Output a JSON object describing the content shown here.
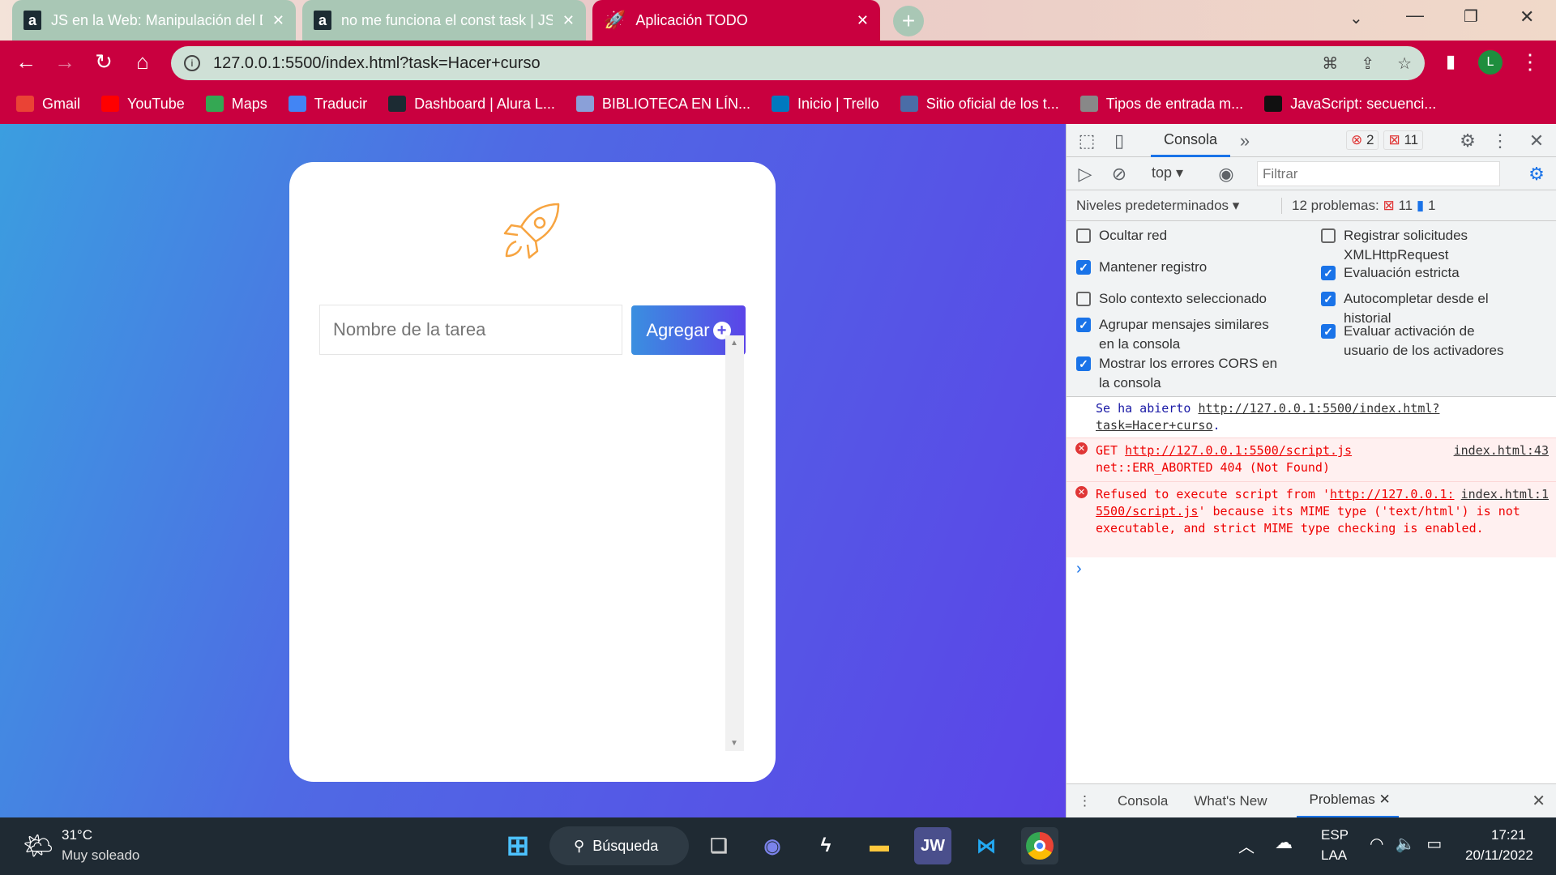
{
  "browser": {
    "tabs": [
      {
        "title": "JS en la Web: Manipulación del D",
        "favicon": "alura-icon",
        "active": false
      },
      {
        "title": "no me funciona el const task | JS",
        "favicon": "alura-icon",
        "active": false
      },
      {
        "title": "Aplicación TODO",
        "favicon": "rocket-icon",
        "active": true
      }
    ],
    "new_tab": "+",
    "url": "127.0.0.1:5500/index.html?task=Hacer+curso",
    "profile_initial": "L",
    "bookmarks": [
      {
        "label": "Gmail",
        "icon": "gmail-icon",
        "color": "#ea4335"
      },
      {
        "label": "YouTube",
        "icon": "youtube-icon",
        "color": "#ff0000"
      },
      {
        "label": "Maps",
        "icon": "maps-icon",
        "color": "#34a853"
      },
      {
        "label": "Traducir",
        "icon": "translate-icon",
        "color": "#4285f4"
      },
      {
        "label": "Dashboard | Alura L...",
        "icon": "alura-icon",
        "color": "#1c2b33"
      },
      {
        "label": "BIBLIOTECA EN LÍN...",
        "icon": "library-icon",
        "color": "#8aa0d8"
      },
      {
        "label": "Inicio | Trello",
        "icon": "trello-icon",
        "color": "#0079bf"
      },
      {
        "label": "Sitio oficial de los t...",
        "icon": "jw-icon",
        "color": "#4a6da7"
      },
      {
        "label": "Tipos de entrada m...",
        "icon": "keyboard-icon",
        "color": "#888888"
      },
      {
        "label": "JavaScript: secuenci...",
        "icon": "m-icon",
        "color": "#111111"
      }
    ]
  },
  "app": {
    "input_placeholder": "Nombre de la tarea",
    "add_button": "Agregar",
    "accent": "#f7a440"
  },
  "devtools": {
    "tab_console": "Consola",
    "more": "»",
    "error_count": "2",
    "warning_count": "11",
    "context": "top",
    "filter_placeholder": "Filtrar",
    "levels": "Niveles predeterminados",
    "problems_label": "12 problemas:",
    "problems_errors": "11",
    "problems_info": "1",
    "settings_left": [
      {
        "label": "Ocultar red",
        "checked": false
      },
      {
        "label": "Mantener registro",
        "checked": true
      },
      {
        "label": "Solo contexto seleccionado",
        "checked": false
      },
      {
        "label": "Agrupar mensajes similares en la consola",
        "checked": true
      },
      {
        "label": "Mostrar los errores CORS en la consola",
        "checked": true
      }
    ],
    "settings_right": [
      {
        "label": "Registrar solicitudes XMLHttpRequest",
        "checked": false
      },
      {
        "label": "Evaluación estricta",
        "checked": true
      },
      {
        "label": "Autocompletar desde el historial",
        "checked": true
      },
      {
        "label": "Evaluar activación de usuario de los activadores",
        "checked": true
      }
    ],
    "messages": {
      "info_prefix": "Se ha abierto ",
      "info_link": "http://127.0.0.1:5500/index.html?task=Hacer+curso",
      "info_suffix": ".",
      "err1_method": "GET ",
      "err1_link": "http://127.0.0.1:5500/script.js",
      "err1_source": "index.html:43",
      "err1_detail": "net::ERR_ABORTED 404 (Not Found)",
      "err2_prefix": "Refused to execute script from '",
      "err2_link": "http://127.0.0.1:5500/script.js",
      "err2_source": "index.html:1",
      "err2_suffix": "' because its MIME type ('text/html') is not executable, and strict MIME type checking is enabled."
    },
    "prompt": "›",
    "drawer_tabs": [
      "Consola",
      "What's New",
      "Problemas"
    ]
  },
  "taskbar": {
    "weather_temp": "31°C",
    "weather_desc": "Muy soleado",
    "search": "Búsqueda",
    "lang1": "ESP",
    "lang2": "LAA",
    "time": "17:21",
    "date": "20/11/2022"
  }
}
